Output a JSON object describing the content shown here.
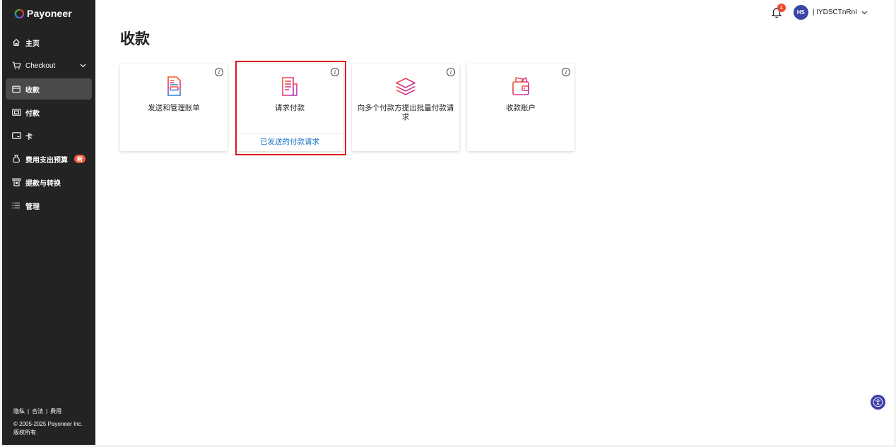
{
  "brand": {
    "name": "Payoneer"
  },
  "sidebar": {
    "items": [
      {
        "label": "主页",
        "icon": "home-icon"
      },
      {
        "label": "Checkout",
        "icon": "cart-icon"
      },
      {
        "label": "收款",
        "icon": "receive-icon",
        "active": true
      },
      {
        "label": "付款",
        "icon": "pay-icon"
      },
      {
        "label": "卡",
        "icon": "card-icon"
      },
      {
        "label": "费用支出预算",
        "icon": "budget-icon",
        "badge": "新"
      },
      {
        "label": "提款与转换",
        "icon": "withdraw-icon"
      },
      {
        "label": "管理",
        "icon": "list-icon"
      }
    ],
    "footer": {
      "links": [
        "隐私",
        "合法",
        "费用"
      ],
      "separator": "|",
      "copyright": "© 2005-2025 Payoneer Inc.",
      "rights": "版权所有"
    }
  },
  "header": {
    "notification_count": "1",
    "avatar_initials": "HS",
    "user_name": "| IYDSCTnRnI"
  },
  "page": {
    "title": "收款"
  },
  "cards": [
    {
      "label": "发送和管理账单",
      "info": "i"
    },
    {
      "label": "请求付款",
      "info": "i",
      "link": "已发送的付款请求"
    },
    {
      "label": "向多个付款方提出批量付款请求",
      "info": "i"
    },
    {
      "label": "收款账户",
      "info": "i"
    }
  ],
  "colors": {
    "sidebar_bg": "#232323",
    "active_item_bg": "#4a4a4a",
    "accent_blue": "#1e78c8",
    "highlight_red": "#e2141c",
    "avatar_bg": "#3b46a8"
  }
}
